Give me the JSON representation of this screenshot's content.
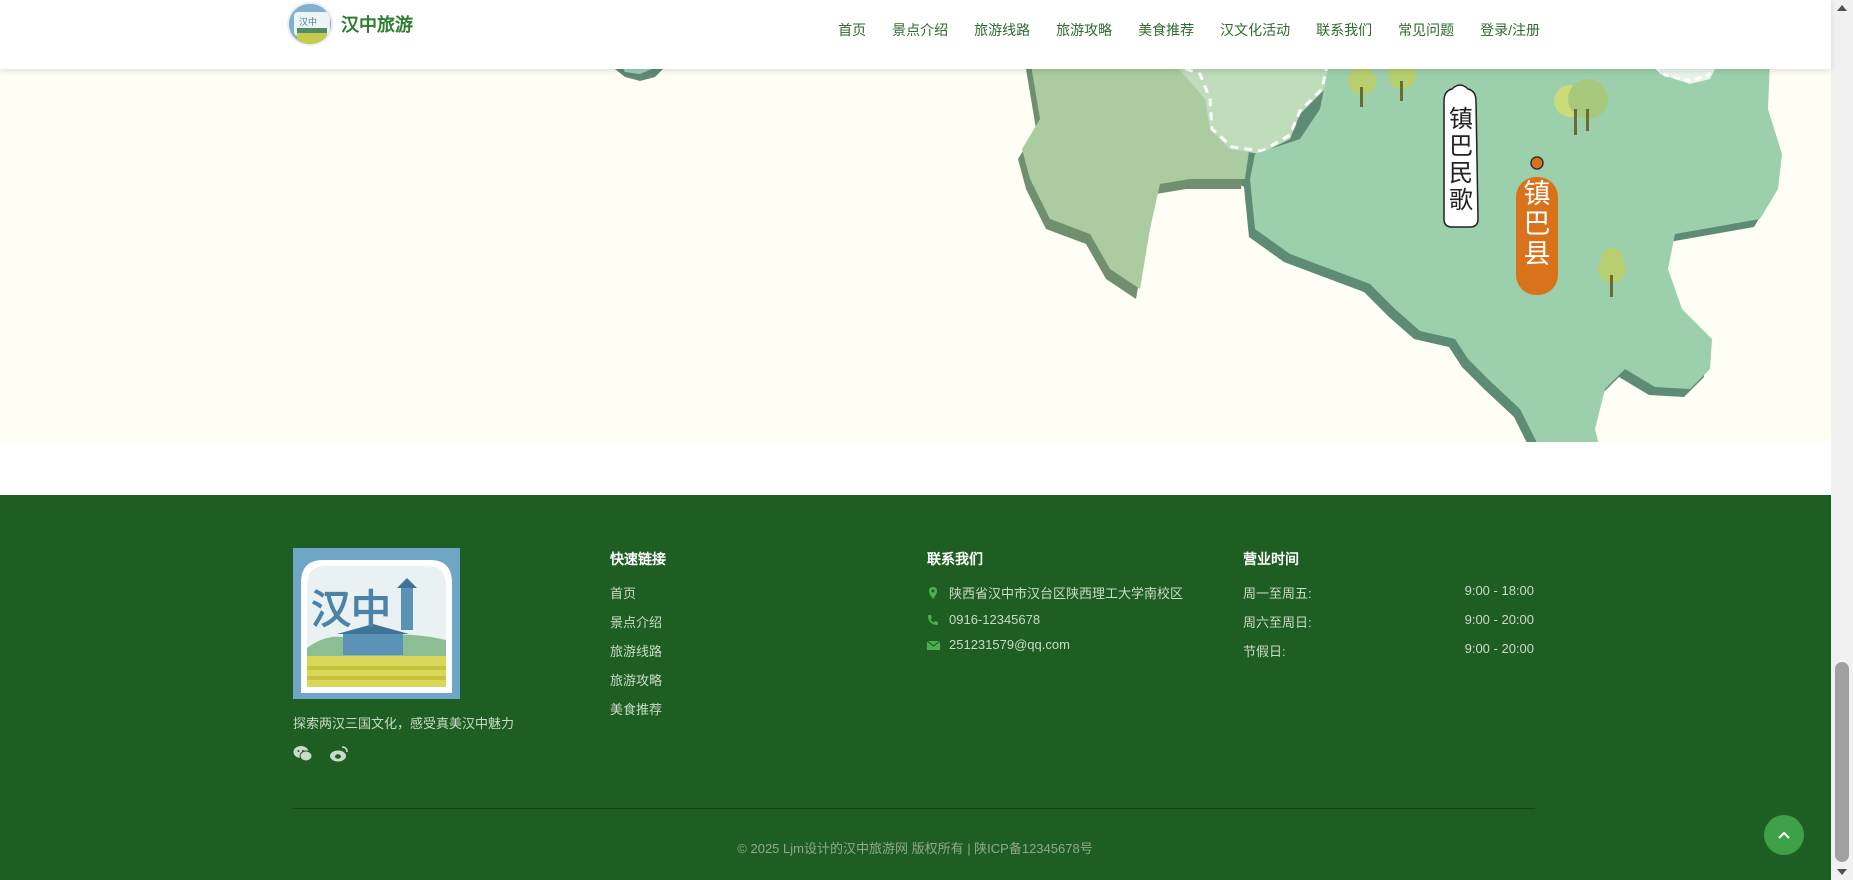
{
  "header": {
    "site_name": "汉中旅游",
    "nav": [
      "首页",
      "景点介绍",
      "旅游线路",
      "旅游攻略",
      "美食推荐",
      "汉文化活动",
      "联系我们",
      "常见问题",
      "登录/注册"
    ]
  },
  "map": {
    "folk_song_label": "镇巴民歌",
    "county_label": "镇巴县"
  },
  "footer": {
    "logo_text": "汉中",
    "tagline": "探索两汉三国文化，感受真美汉中魅力",
    "social_icons": [
      "wechat-icon",
      "weibo-icon"
    ],
    "quick_links": {
      "title": "快速链接",
      "items": [
        "首页",
        "景点介绍",
        "旅游线路",
        "旅游攻略",
        "美食推荐"
      ]
    },
    "contact": {
      "title": "联系我们",
      "address": "陕西省汉中市汉台区陕西理工大学南校区",
      "phone": "0916-12345678",
      "email": "251231579@qq.com"
    },
    "hours": {
      "title": "营业时间",
      "rows": [
        {
          "label": "周一至周五:",
          "value": "9:00 - 18:00"
        },
        {
          "label": "周六至周日:",
          "value": "9:00 - 20:00"
        },
        {
          "label": "节假日:",
          "value": "9:00 - 20:00"
        }
      ]
    },
    "copyright": "© 2025 Ljm设计的汉中旅游网 版权所有 | 陕ICP备12345678号"
  },
  "colors": {
    "brand_green": "#2e7d32",
    "footer_bg": "#1e5e22",
    "map_green": "#9ccfab",
    "county_orange": "#d9731b"
  }
}
